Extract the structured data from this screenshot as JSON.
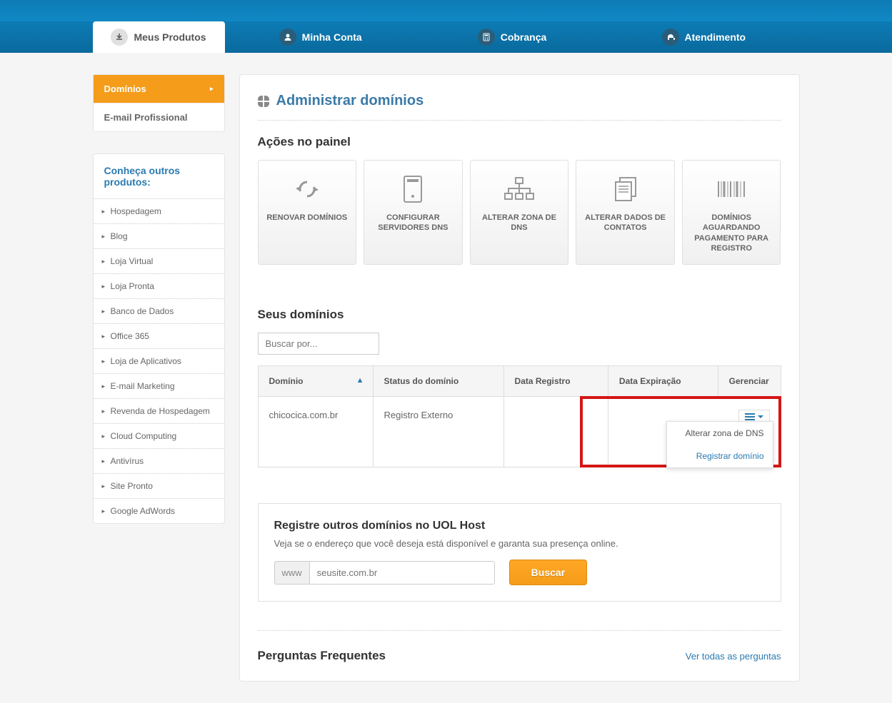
{
  "nav": {
    "tabs": [
      {
        "label": "Meus Produtos"
      },
      {
        "label": "Minha Conta"
      },
      {
        "label": "Cobrança"
      },
      {
        "label": "Atendimento"
      }
    ]
  },
  "sidebar": {
    "menu": [
      {
        "label": "Domínios"
      },
      {
        "label": "E-mail Profissional"
      }
    ],
    "other_title": "Conheça outros produtos:",
    "products": [
      "Hospedagem",
      "Blog",
      "Loja Virtual",
      "Loja Pronta",
      "Banco de Dados",
      "Office 365",
      "Loja de Aplicativos",
      "E-mail Marketing",
      "Revenda de Hospedagem",
      "Cloud Computing",
      "Antivírus",
      "Site Pronto",
      "Google AdWords"
    ]
  },
  "page": {
    "title": "Administrar domínios",
    "actions_heading": "Ações no painel",
    "actions": [
      "RENOVAR DOMÍNIOS",
      "CONFIGURAR SERVIDORES DNS",
      "ALTERAR ZONA DE DNS",
      "ALTERAR DADOS DE CONTATOS",
      "DOMÍNIOS AGUARDANDO PAGAMENTO PARA REGISTRO"
    ],
    "domains_heading": "Seus domínios",
    "search_placeholder": "Buscar por...",
    "table": {
      "headers": {
        "domain": "Domínio",
        "status": "Status do domínio",
        "reg_date": "Data Registro",
        "exp_date": "Data Expiração",
        "manage": "Gerenciar"
      },
      "rows": [
        {
          "domain": "chicocica.com.br",
          "status": "Registro Externo",
          "reg_date": "",
          "exp_date": ""
        }
      ]
    },
    "dropdown": {
      "item1": "Alterar zona de DNS",
      "item2": "Registrar domínio"
    },
    "register": {
      "title": "Registre outros domínios no UOL Host",
      "desc": "Veja se o endereço que você deseja está disponível e garanta sua presença online.",
      "addon": "www",
      "placeholder": "seusite.com.br",
      "button": "Buscar"
    },
    "faq": {
      "title": "Perguntas Frequentes",
      "link": "Ver todas as perguntas"
    }
  }
}
